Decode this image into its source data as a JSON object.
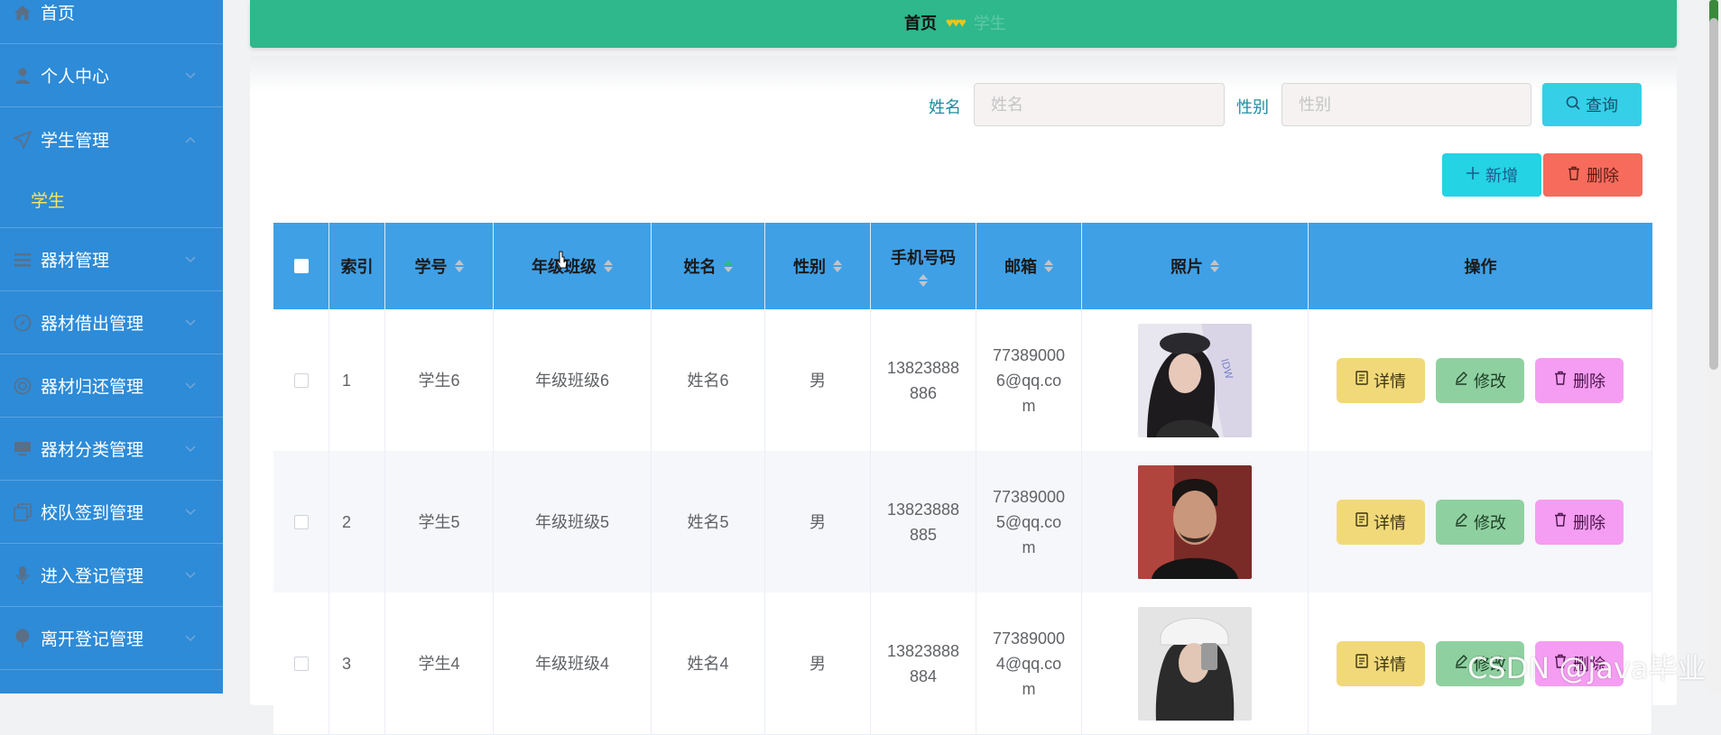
{
  "sidebar": {
    "items": [
      {
        "label": "首页",
        "icon": "home-icon"
      },
      {
        "label": "个人中心",
        "icon": "user-icon"
      },
      {
        "label": "学生管理",
        "icon": "send-icon"
      },
      {
        "label": "器材管理",
        "icon": "menu-icon"
      },
      {
        "label": "器材借出管理",
        "icon": "compass-icon"
      },
      {
        "label": "器材归还管理",
        "icon": "lifebuoy-icon"
      },
      {
        "label": "器材分类管理",
        "icon": "monitor-icon"
      },
      {
        "label": "校队签到管理",
        "icon": "copy-icon"
      },
      {
        "label": "进入登记管理",
        "icon": "microphone-icon"
      },
      {
        "label": "离开登记管理",
        "icon": "balloon-icon"
      }
    ],
    "subitem": {
      "label": "学生"
    }
  },
  "header": {
    "breadcrumb_home": "首页",
    "breadcrumb_sep": "♥♥♥",
    "breadcrumb_current": "学生"
  },
  "search": {
    "name_label": "姓名",
    "name_placeholder": "姓名",
    "gender_label": "性别",
    "gender_placeholder": "性别",
    "query_label": "查询",
    "add_label": "新增",
    "delete_label": "删除"
  },
  "table": {
    "headers": [
      "索引",
      "学号",
      "年级班级",
      "姓名",
      "性别",
      "手机号码",
      "邮箱",
      "照片",
      "操作"
    ],
    "rows": [
      {
        "index": "1",
        "student_no": "学生6",
        "class": "年级班级6",
        "name": "姓名6",
        "gender": "男",
        "phone_1": "13823888",
        "phone_2": "886",
        "email_1": "77389000",
        "email_2": "6@qq.co",
        "email_3": "m"
      },
      {
        "index": "2",
        "student_no": "学生5",
        "class": "年级班级5",
        "name": "姓名5",
        "gender": "男",
        "phone_1": "13823888",
        "phone_2": "885",
        "email_1": "77389000",
        "email_2": "5@qq.co",
        "email_3": "m"
      },
      {
        "index": "3",
        "student_no": "学生4",
        "class": "年级班级4",
        "name": "姓名4",
        "gender": "男",
        "phone_1": "13823888",
        "phone_2": "884",
        "email_1": "77389000",
        "email_2": "4@qq.co",
        "email_3": "m"
      }
    ],
    "op_detail": "详情",
    "op_edit": "修改",
    "op_delete": "删除"
  },
  "watermark": "CSDN @java毕业",
  "colors": {
    "sidebar": "#2d8bd8",
    "header": "#2eb88c",
    "table_header": "#3fa0e6",
    "submenu_active": "#f7e85a",
    "btn_query": "#35cfe8",
    "btn_add": "#24d3e4",
    "btn_delete": "#f76b5c",
    "op_detail": "#f1d97a",
    "op_edit": "#8fd0a0",
    "op_delete": "#f59df2"
  }
}
